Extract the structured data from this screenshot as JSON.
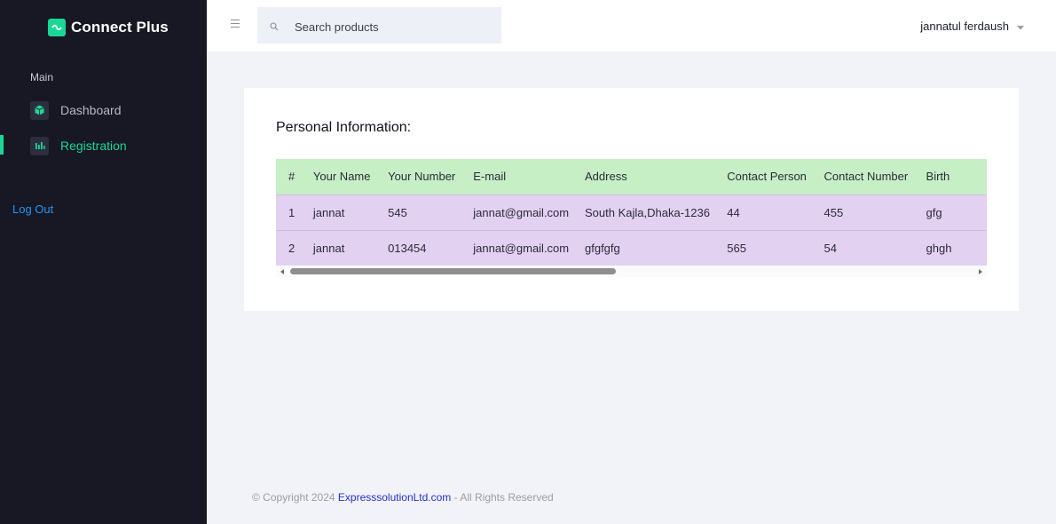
{
  "brand": {
    "name": "Connect Plus"
  },
  "sidebar": {
    "section_label": "Main",
    "items": [
      {
        "label": "Dashboard",
        "icon": "cube-icon",
        "active": false
      },
      {
        "label": "Registration",
        "icon": "bar-chart-icon",
        "active": true
      }
    ],
    "logout_label": "Log Out"
  },
  "navbar": {
    "search_placeholder": "Search products",
    "user_name": "jannatul ferdaush"
  },
  "main": {
    "title": "Personal Information:",
    "table": {
      "columns": [
        "#",
        "Your Name",
        "Your Number",
        "E-mail",
        "Address",
        "Contact Person",
        "Contact Number",
        "Birth"
      ],
      "rows": [
        [
          "1",
          "jannat",
          "545",
          "jannat@gmail.com",
          "South Kajla,Dhaka-1236",
          "44",
          "455",
          "gfg"
        ],
        [
          "2",
          "jannat",
          "013454",
          "jannat@gmail.com",
          "gfgfgfg",
          "565",
          "54",
          "ghgh"
        ]
      ]
    }
  },
  "footer": {
    "prefix": "© Copyright 2024 ",
    "link": "ExpresssolutionLtd.com",
    "suffix": " - All Rights Reserved"
  },
  "colors": {
    "sidebar_bg": "#181824",
    "accent": "#19d895",
    "header_row": "#c6efc6",
    "body_row": "#e3d1f2",
    "link": "#2196f3"
  }
}
